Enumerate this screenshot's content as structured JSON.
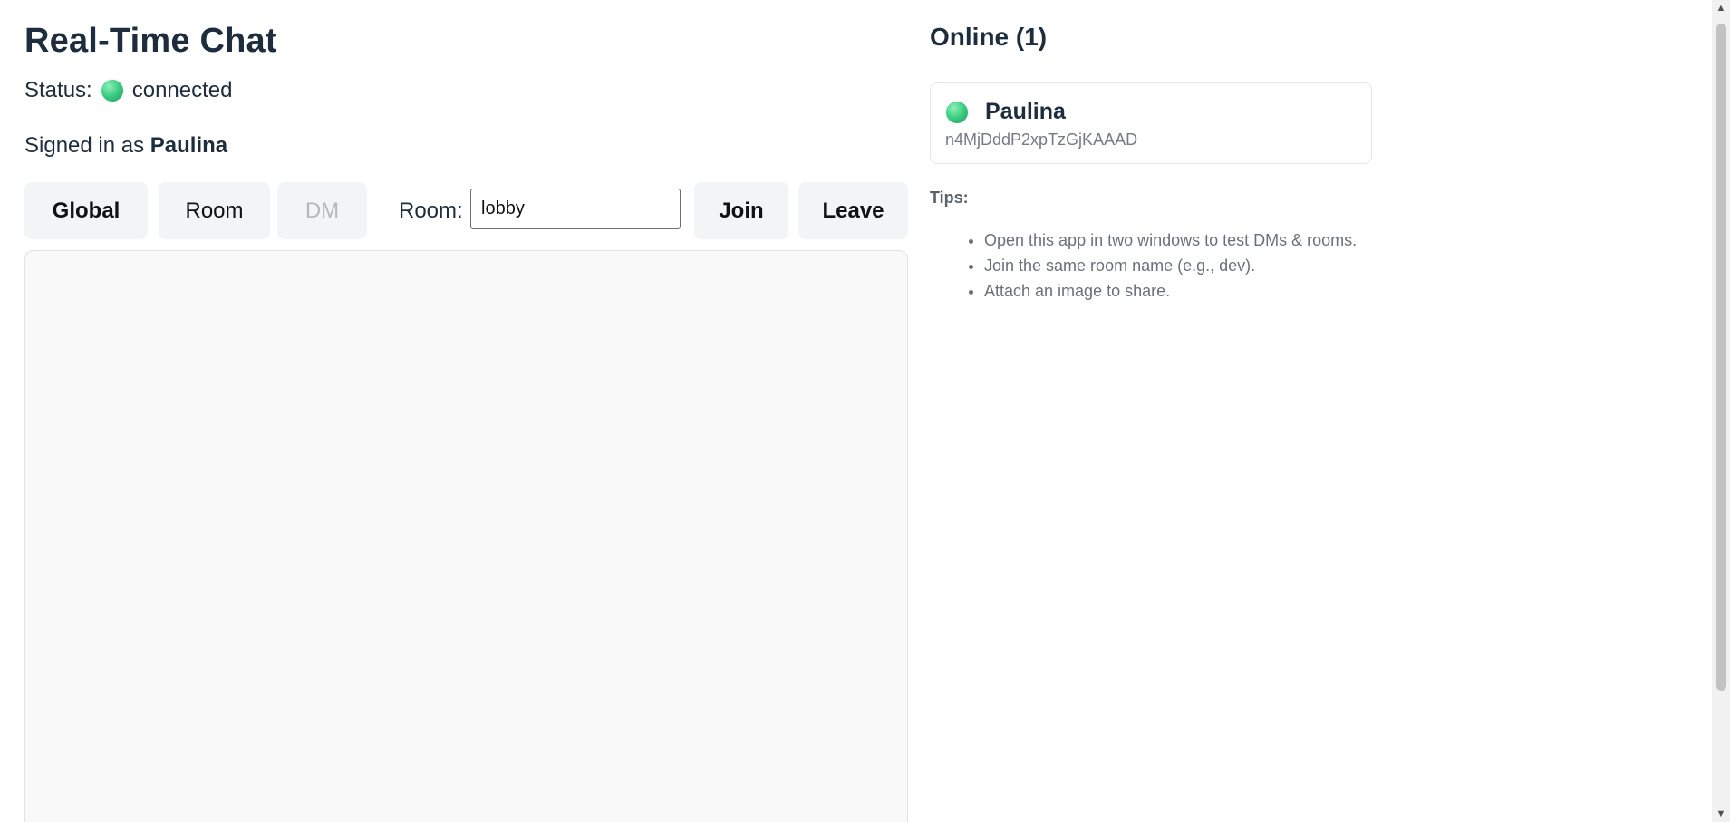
{
  "app": {
    "title": "Real-Time Chat"
  },
  "status": {
    "label": "Status:",
    "value": "connected",
    "color": "#3fcf86"
  },
  "session": {
    "signed_in_prefix": "Signed in as",
    "username": "Paulina"
  },
  "toolbar": {
    "global_label": "Global",
    "room_label": "Room",
    "dm_label": "DM",
    "room_field_label": "Room:",
    "room_value": "lobby",
    "join_label": "Join",
    "leave_label": "Leave"
  },
  "sidebar": {
    "online_title": "Online (1)",
    "users": [
      {
        "name": "Paulina",
        "id": "n4MjDddP2xpTzGjKAAAD",
        "online": true
      }
    ],
    "tips_label": "Tips:",
    "tips": [
      "Open this app in two windows to test DMs & rooms.",
      "Join the same room name (e.g., dev).",
      "Attach an image to share."
    ]
  },
  "icons": {
    "status": "status-online-icon",
    "scroll_up": "scroll-up-arrow-icon",
    "scroll_down": "scroll-down-arrow-icon"
  }
}
